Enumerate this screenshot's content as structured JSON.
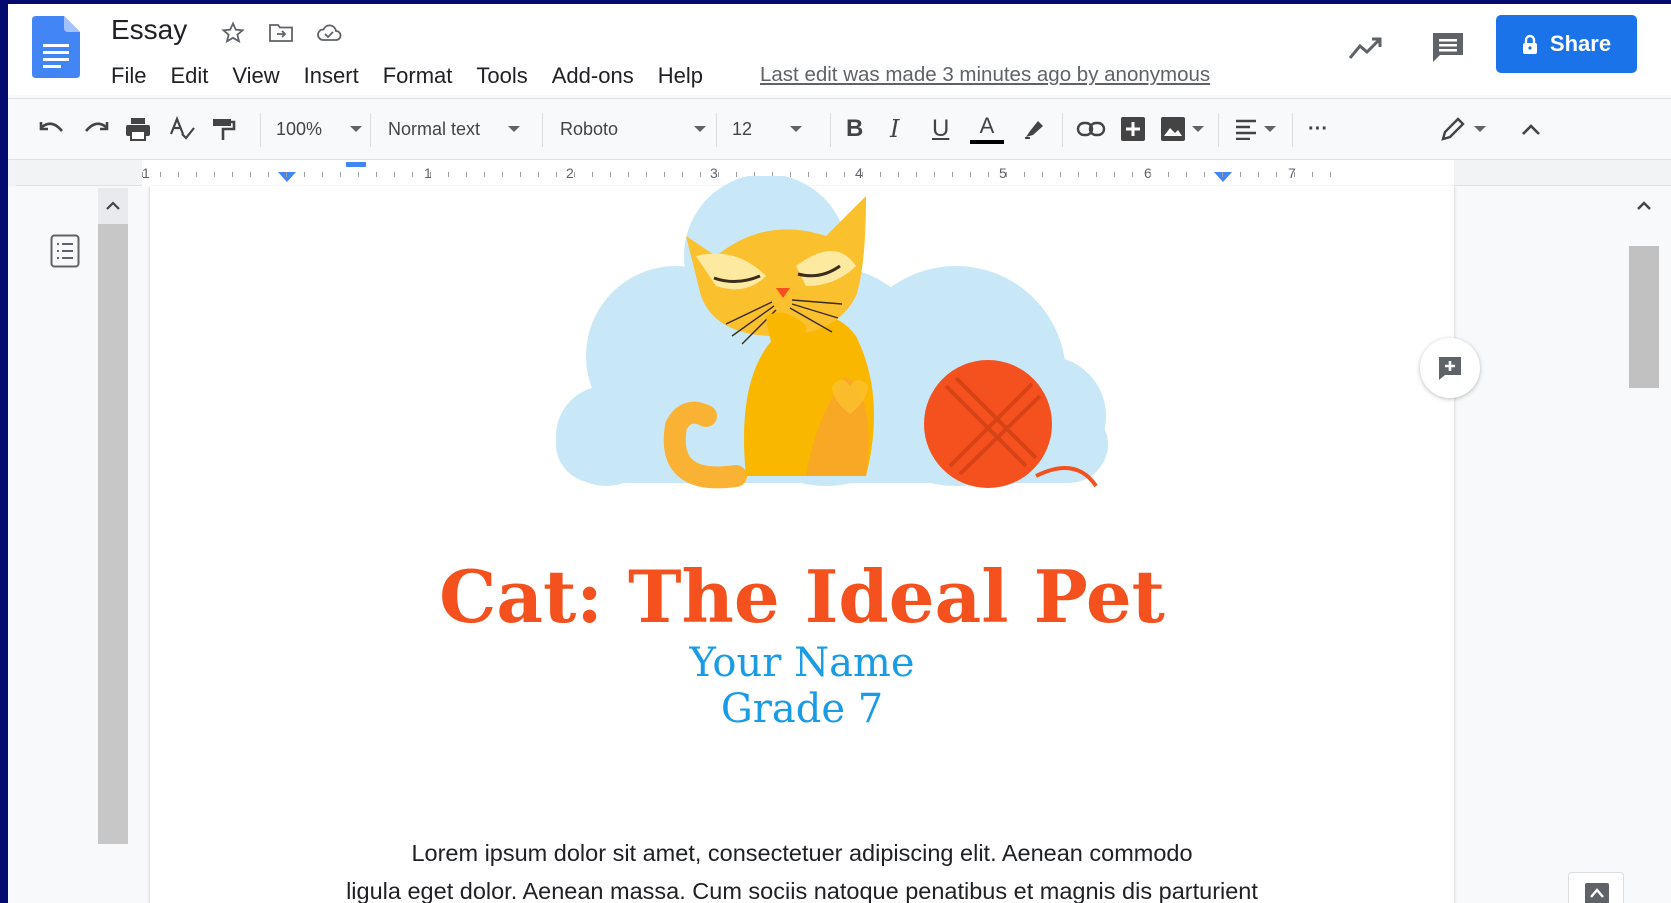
{
  "app": {
    "doc_title": "Essay",
    "last_edit": "Last edit was made 3 minutes ago by anonymous",
    "share_label": "Share"
  },
  "menu": [
    "File",
    "Edit",
    "View",
    "Insert",
    "Format",
    "Tools",
    "Add-ons",
    "Help"
  ],
  "toolbar": {
    "zoom": "100%",
    "style": "Normal text",
    "font": "Roboto",
    "font_size": "12",
    "bold": "B",
    "italic": "I",
    "underline": "U",
    "text_color": "A",
    "more": "···"
  },
  "ruler": {
    "numbers": [
      "1",
      "1",
      "2",
      "3",
      "4",
      "5",
      "6",
      "7"
    ]
  },
  "document": {
    "heading": "Cat: The Ideal Pet",
    "name": "Your Name",
    "grade": "Grade 7",
    "body_line1": "Lorem ipsum dolor sit amet, consectetuer adipiscing elit. Aenean commodo",
    "body_line2": "ligula eget dolor. Aenean massa. Cum sociis natoque penatibus et magnis dis parturient"
  },
  "colors": {
    "accent": "#1a73e8",
    "heading": "#f4511e",
    "subheading": "#1a9be6"
  },
  "icons": {
    "doc_logo": "google-docs-icon",
    "star": "star-icon",
    "move": "move-to-folder-icon",
    "cloud": "cloud-status-icon",
    "activity": "activity-trend-icon",
    "comments": "comments-icon",
    "lock": "lock-icon"
  }
}
